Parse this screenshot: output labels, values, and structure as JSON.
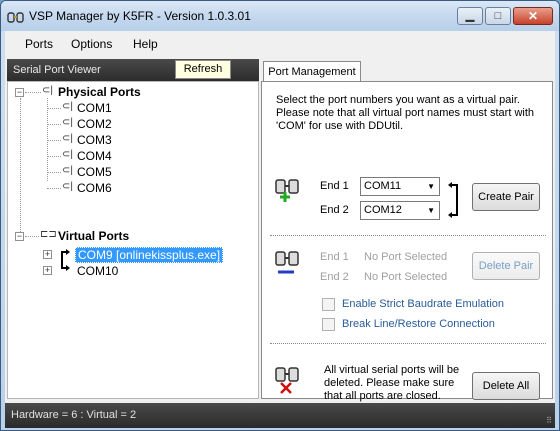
{
  "window": {
    "title": "VSP Manager by K5FR - Version 1.0.3.01",
    "minimize_glyph": "▁",
    "maximize_glyph": "□",
    "close_glyph": "✕"
  },
  "menu": [
    "Ports",
    "Options",
    "Help"
  ],
  "left_panel": {
    "header": "Serial Port Viewer",
    "refresh_label": "Refresh",
    "physical_label": "Physical Ports",
    "physical_ports": [
      "COM1",
      "COM2",
      "COM3",
      "COM4",
      "COM5",
      "COM6"
    ],
    "virtual_label": "Virtual Ports",
    "virtual_ports": [
      "COM9 [onlinekissplus.exe]",
      "COM10"
    ]
  },
  "right_panel": {
    "tab_label": "Port Management",
    "description": "Select the port numbers you want as a virtual pair. Please note that all virtual port names must start with 'COM' for use with DDUtil.",
    "create": {
      "end1_label": "End 1",
      "end2_label": "End 2",
      "end1_value": "COM11",
      "end2_value": "COM12",
      "button": "Create Pair"
    },
    "delete": {
      "end1_label": "End 1",
      "end2_label": "End 2",
      "end1_value": "No Port Selected",
      "end2_value": "No Port Selected",
      "button": "Delete Pair",
      "strict_baud": "Enable Strict Baudrate Emulation",
      "break_line": "Break Line/Restore Connection"
    },
    "delete_all": {
      "message": "All virtual serial ports will be deleted. Please make sure that all ports are closed.",
      "button": "Delete All"
    }
  },
  "status": {
    "text": "Hardware = 6  :  Virtual = 2"
  },
  "colors": {
    "selection": "#3399ff",
    "add_green": "#22aa22",
    "remove_blue": "#1f3fbf",
    "delete_red": "#d01010"
  }
}
